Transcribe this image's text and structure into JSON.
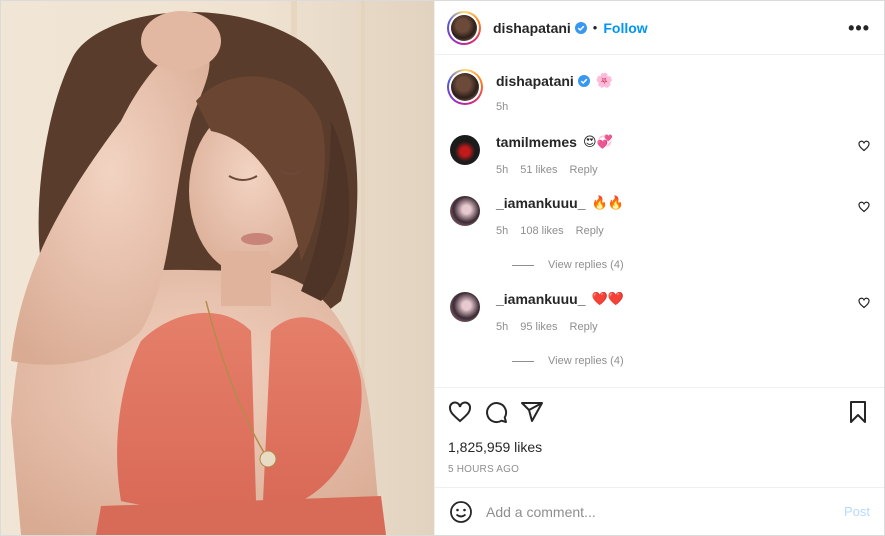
{
  "post": {
    "username": "dishapatani",
    "follow_label": "Follow",
    "separator": "•",
    "more_label": "•••"
  },
  "caption": {
    "username": "dishapatani",
    "text": "🌸",
    "time": "5h"
  },
  "comments": [
    {
      "username": "tamilmemes",
      "text": "😍💞",
      "time": "5h",
      "likes": "51 likes",
      "reply": "Reply",
      "view_replies": ""
    },
    {
      "username": "_iamankuuu_",
      "text": "🔥🔥",
      "time": "5h",
      "likes": "108 likes",
      "reply": "Reply",
      "view_replies": "View replies (4)"
    },
    {
      "username": "_iamankuuu_",
      "text": "❤️❤️",
      "time": "5h",
      "likes": "95 likes",
      "reply": "Reply",
      "view_replies": "View replies (4)"
    }
  ],
  "stats": {
    "likes": "1,825,959 likes",
    "posted": "5 HOURS AGO"
  },
  "add_comment": {
    "placeholder": "Add a comment...",
    "post_label": "Post"
  },
  "colors": {
    "accent": "#0095f6",
    "muted": "#8e8e8e",
    "post_disabled": "#b3dbff"
  }
}
